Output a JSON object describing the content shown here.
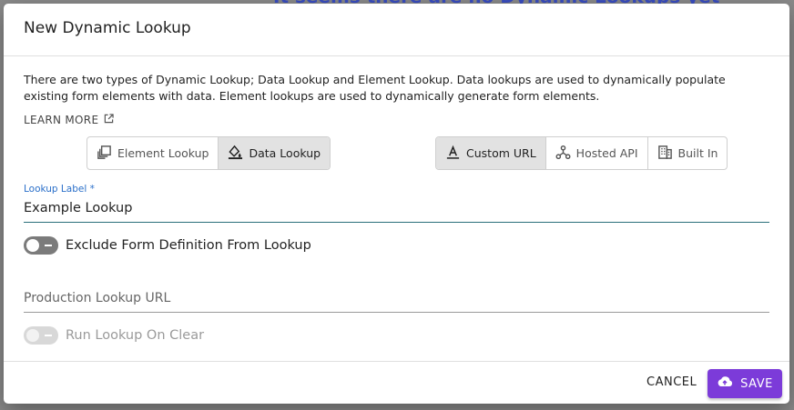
{
  "backdrop": {
    "text": "It seems there are no Dynamic Lookups yet"
  },
  "dialog": {
    "title": "New Dynamic Lookup",
    "description": "There are two types of Dynamic Lookup; Data Lookup and Element Lookup. Data lookups are used to dynamically populate existing form elements with data. Element lookups are used to dynamically generate form elements.",
    "learn_more": "LEARN MORE",
    "type_toggle": {
      "options": [
        "Element Lookup",
        "Data Lookup"
      ],
      "selected": "Data Lookup"
    },
    "source_toggle": {
      "options": [
        "Custom URL",
        "Hosted API",
        "Built In"
      ],
      "selected": "Custom URL"
    },
    "lookup_label": {
      "label": "Lookup Label *",
      "value": "Example Lookup"
    },
    "exclude_toggle": {
      "label": "Exclude Form Definition From Lookup",
      "on": false
    },
    "production_url": {
      "placeholder": "Production Lookup URL",
      "value": ""
    },
    "run_on_clear": {
      "label": "Run Lookup On Clear",
      "on": false,
      "disabled": true
    }
  },
  "footer": {
    "cancel_label": "CANCEL",
    "save_label": "SAVE"
  },
  "colors": {
    "accent": "#7c3bd9",
    "label_blue": "#2a6fc9"
  }
}
